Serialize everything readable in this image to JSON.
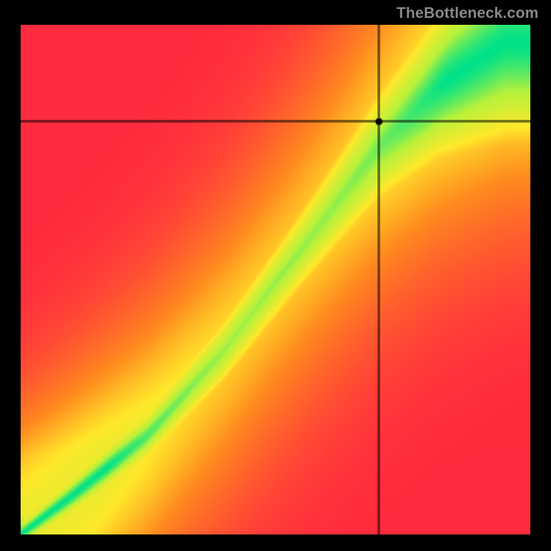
{
  "watermark": "TheBottleneck.com",
  "chart_data": {
    "type": "heatmap",
    "description": "Bottleneck heatmap. Both axes are normalized 0–1 (component A vs component B relative performance). Color encodes bottleneck severity along a diagonal 'balanced' band: green = balanced, yellow = mild mismatch, orange/red = strong bottleneck. A marker indicates the currently selected pair.",
    "x_range": [
      0,
      1
    ],
    "y_range": [
      0,
      1
    ],
    "xlabel": "",
    "ylabel": "",
    "color_scale": {
      "0.00": "#ff2b3f",
      "0.33": "#ff8a1f",
      "0.55": "#ffe82b",
      "0.80": "#b8f23b",
      "1.00": "#00e288"
    },
    "balanced_band": {
      "note": "Center of green band curves from near origin to near top-right; widens with x.",
      "control_points": [
        {
          "x": 0.0,
          "y": 0.0,
          "half_width": 0.01
        },
        {
          "x": 0.1,
          "y": 0.075,
          "half_width": 0.015
        },
        {
          "x": 0.25,
          "y": 0.195,
          "half_width": 0.02
        },
        {
          "x": 0.4,
          "y": 0.36,
          "half_width": 0.028
        },
        {
          "x": 0.55,
          "y": 0.56,
          "half_width": 0.036
        },
        {
          "x": 0.7,
          "y": 0.76,
          "half_width": 0.048
        },
        {
          "x": 0.82,
          "y": 0.88,
          "half_width": 0.062
        },
        {
          "x": 0.95,
          "y": 0.965,
          "half_width": 0.08
        }
      ]
    },
    "marker": {
      "x": 0.703,
      "y": 0.81,
      "radius_px": 5,
      "crosshair": true
    },
    "pixelation": 2
  }
}
